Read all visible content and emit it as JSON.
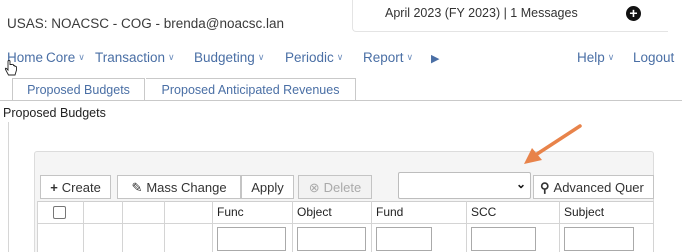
{
  "app": {
    "title": "USAS:  NOACSC - COG  -  brenda@noacsc.lan",
    "period_status": "April 2023 (FY 2023) | 1 Messages"
  },
  "menu": {
    "items": [
      {
        "label": "Home",
        "has_dropdown": false
      },
      {
        "label": "Core",
        "has_dropdown": true
      },
      {
        "label": "Transaction",
        "has_dropdown": true
      },
      {
        "label": "Budgeting",
        "has_dropdown": true
      },
      {
        "label": "Periodic",
        "has_dropdown": true
      },
      {
        "label": "Report",
        "has_dropdown": true
      }
    ],
    "more_glyph": "▶",
    "help": "Help",
    "logout": "Logout"
  },
  "tabs": [
    {
      "label": "Proposed Budgets",
      "active": true
    },
    {
      "label": "Proposed Anticipated Revenues",
      "active": false
    }
  ],
  "page": {
    "heading": "Proposed Budgets"
  },
  "toolbar": {
    "create": "Create",
    "mass_change": "Mass Change",
    "apply": "Apply",
    "delete": "Delete",
    "advanced_query": "Advanced Quer",
    "select_value": ""
  },
  "grid": {
    "columns": [
      "Func",
      "Object",
      "Fund",
      "SCC",
      "Subject"
    ]
  },
  "colors": {
    "link": "#4a6fa5",
    "annotation_arrow": "#e8834a"
  },
  "icons": {
    "create": "plus-icon",
    "mass_change": "edit-icon",
    "delete": "x-circle-icon",
    "advanced_query": "search-icon",
    "messages": "plus-circle-icon"
  }
}
